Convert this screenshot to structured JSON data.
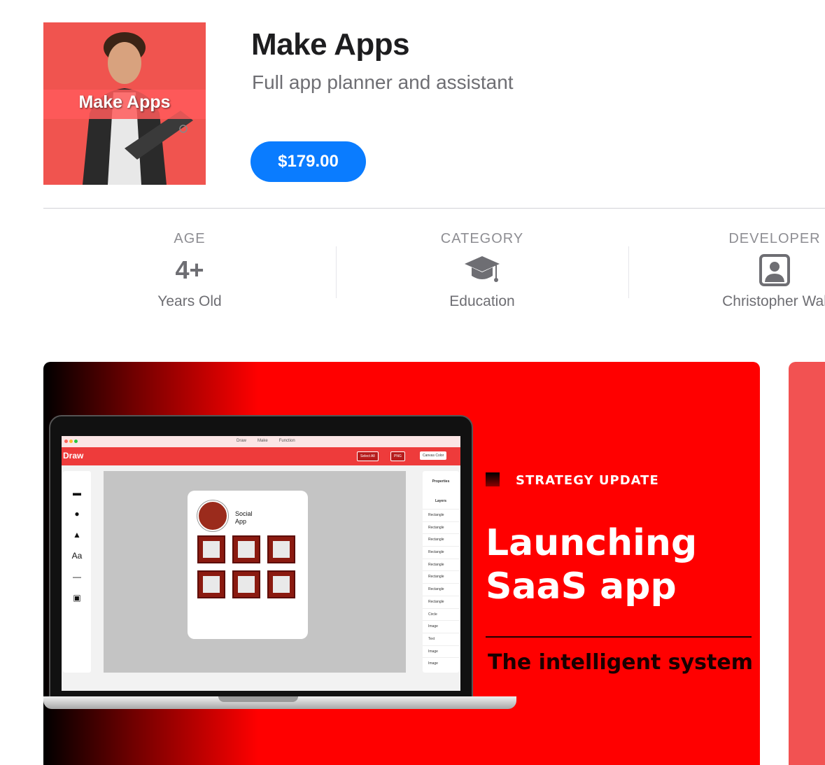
{
  "app": {
    "icon_text": "Make Apps",
    "title": "Make Apps",
    "subtitle": "Full app planner and assistant",
    "price": "$179.00"
  },
  "info": {
    "age": {
      "caption": "AGE",
      "value": "4+",
      "sub": "Years Old"
    },
    "category": {
      "caption": "CATEGORY",
      "icon": "graduation-cap-icon",
      "sub": "Education"
    },
    "developer": {
      "caption": "DEVELOPER",
      "icon": "person-portrait-icon",
      "sub": "Christopher Wal"
    }
  },
  "screenshot": {
    "mac_tabs": [
      "Draw",
      "Make",
      "Function"
    ],
    "app_bar_title": "Draw",
    "select_all": "Select All",
    "png": "PNG",
    "canvas_color": "Canvas Color",
    "tools": [
      "▬",
      "●",
      "▲",
      "Aa",
      "—",
      "▣"
    ],
    "phone_title": "Social App",
    "properties": "Properties",
    "layers_heading": "Layers",
    "layers": [
      "Rectangle",
      "Rectangle",
      "Rectangle",
      "Rectangle",
      "Rectangle",
      "Rectangle",
      "Rectangle",
      "Rectangle",
      "Circle",
      "Image",
      "Text",
      "Image",
      "Image"
    ],
    "strategy_label": "STRATEGY UPDATE",
    "headline": "Launching SaaS app",
    "tagline": "The intelligent system"
  },
  "colors": {
    "accent": "#0a7cff",
    "brand_red": "#ff0000"
  }
}
